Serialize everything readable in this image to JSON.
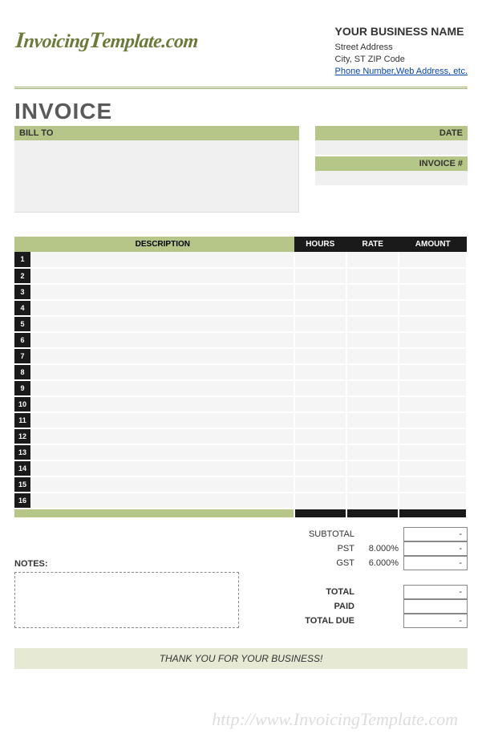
{
  "logo_text": "InvoicingTemplate.com",
  "business": {
    "name": "YOUR BUSINESS NAME",
    "street": "Street Address",
    "city": "City, ST  ZIP Code",
    "link": "Phone Number,Web Address, etc."
  },
  "invoice_title": "INVOICE",
  "billto_label": "BILL TO",
  "date_label": "DATE",
  "invno_label": "INVOICE #",
  "columns": {
    "description": "DESCRIPTION",
    "hours": "HOURS",
    "rate": "RATE",
    "amount": "AMOUNT"
  },
  "rows": [
    "1",
    "2",
    "3",
    "4",
    "5",
    "6",
    "7",
    "8",
    "9",
    "10",
    "11",
    "12",
    "13",
    "14",
    "15",
    "16"
  ],
  "totals": {
    "subtotal_label": "SUBTOTAL",
    "subtotal_val": "-",
    "pst_label": "PST",
    "pst_pct": "8.000%",
    "pst_val": "-",
    "gst_label": "GST",
    "gst_pct": "6.000%",
    "gst_val": "-",
    "total_label": "TOTAL",
    "total_val": "-",
    "paid_label": "PAID",
    "paid_val": "",
    "due_label": "TOTAL DUE",
    "due_val": "-"
  },
  "notes_label": "NOTES:",
  "thank_you": "THANK YOU FOR YOUR BUSINESS!",
  "watermark": "http://www.InvoicingTemplate.com"
}
